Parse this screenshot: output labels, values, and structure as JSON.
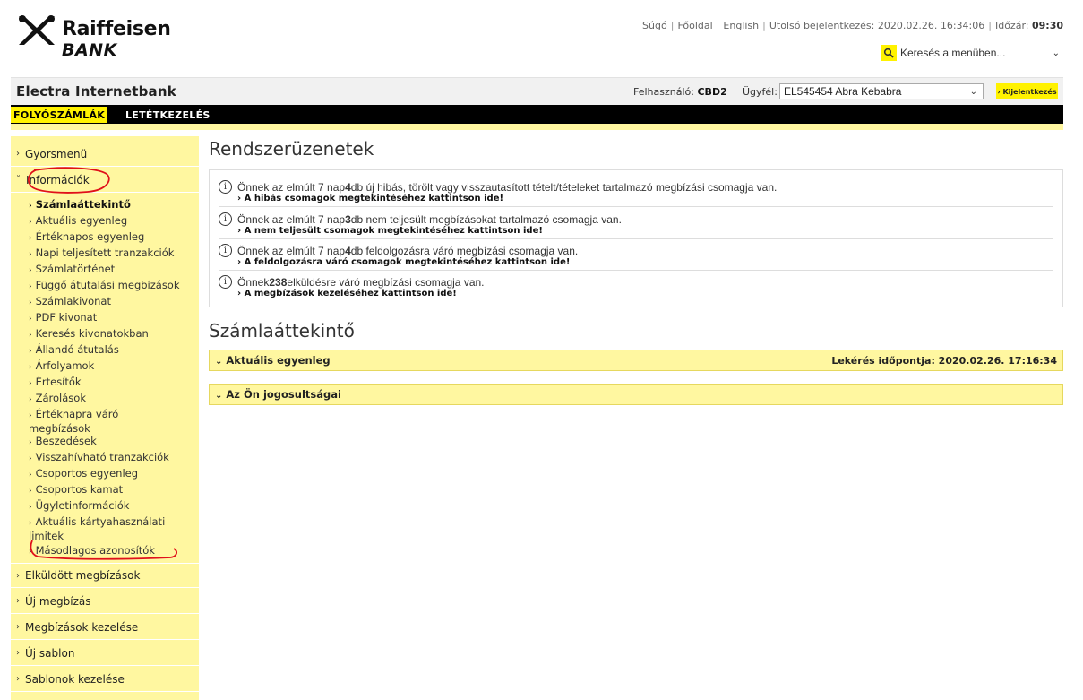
{
  "brand": {
    "line1": "Raiffeisen",
    "line2": "BANK"
  },
  "toplinks": {
    "help": "Súgó",
    "home": "Főoldal",
    "english": "English",
    "last_login_label": "Utolsó bejelentkezés:",
    "last_login_value": "2020.02.26. 16:34:06",
    "timer_label": "Időzár:",
    "timer_value": "09:30"
  },
  "search": {
    "placeholder": "Keresés a menüben..."
  },
  "app_bar": {
    "title": "Electra Internetbank",
    "user_label": "Felhasználó:",
    "user_value": "CBD2",
    "client_label": "Ügyfél:",
    "client_value": "EL545454 Abra Kebabra",
    "logout": "› Kijelentkezés"
  },
  "nav": {
    "tabs": [
      {
        "label": "FOLYÓSZÁMLÁK",
        "active": true
      },
      {
        "label": "LETÉTKEZELÉS",
        "active": false
      }
    ]
  },
  "sidebar": {
    "top_items": [
      {
        "label": "Gyorsmenü"
      },
      {
        "label": "Információk"
      }
    ],
    "sub_items": [
      "Számlaáttekintő",
      "Aktuális egyenleg",
      "Értéknapos egyenleg",
      "Napi teljesített tranzakciók",
      "Számlatörténet",
      "Függő átutalási megbízások",
      "Számlakivonat",
      "PDF kivonat",
      "Keresés kivonatokban",
      "Állandó átutalás",
      "Árfolyamok",
      "Értesítők",
      "Zárolások",
      "Értéknapra váró megbízások",
      "Beszedések",
      "Visszahívható tranzakciók",
      "Csoportos egyenleg",
      "Csoportos kamat",
      "Ügyletinformációk",
      "Aktuális kártyahasználati limitek",
      "Másodlagos azonosítók"
    ],
    "bottom_items": [
      {
        "label": "Elküldött megbízások"
      },
      {
        "label": "Új megbízás"
      },
      {
        "label": "Megbízások kezelése"
      },
      {
        "label": "Új sablon"
      },
      {
        "label": "Sablonok kezelése"
      }
    ]
  },
  "system_messages": {
    "title": "Rendszerüzenetek",
    "items": [
      {
        "pre": "Önnek az elmúlt 7 nap ",
        "num": "4",
        "post": " db új hibás, törölt vagy visszautasított tételt/tételeket tartalmazó megbízási csomagja van.",
        "link": "› A hibás csomagok megtekintéséhez kattintson ide!"
      },
      {
        "pre": "Önnek az elmúlt 7 nap ",
        "num": "3",
        "post": " db nem teljesült megbízásokat tartalmazó csomagja van.",
        "link": "› A nem teljesült csomagok megtekintéséhez kattintson ide!"
      },
      {
        "pre": "Önnek az elmúlt 7 nap ",
        "num": "4",
        "post": " db feldolgozásra váró megbízási csomagja van.",
        "link": "› A feldolgozásra váró csomagok megtekintéséhez kattintson ide!"
      },
      {
        "pre": "Önnek ",
        "num": "238",
        "post": " elküldésre váró megbízási csomagja van.",
        "link": "› A megbízások kezeléséhez kattintson ide!"
      }
    ]
  },
  "overview": {
    "title": "Számlaáttekintő",
    "panels": [
      {
        "label": "Aktuális egyenleg",
        "right": "Lekérés időpontja: 2020.02.26. 17:16:34"
      },
      {
        "label": "Az Ön jogosultságai",
        "right": ""
      }
    ]
  }
}
